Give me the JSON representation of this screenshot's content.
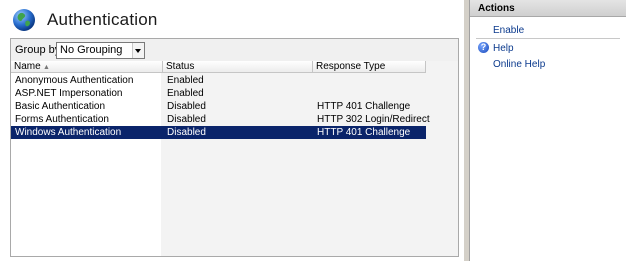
{
  "header": {
    "title": "Authentication",
    "icon": "globe-icon"
  },
  "groupby": {
    "label": "Group by:",
    "value": "No Grouping"
  },
  "table": {
    "columns": [
      "Name",
      "Status",
      "Response Type"
    ],
    "rows": [
      {
        "name": "Anonymous Authentication",
        "status": "Enabled",
        "response": ""
      },
      {
        "name": "ASP.NET Impersonation",
        "status": "Enabled",
        "response": ""
      },
      {
        "name": "Basic Authentication",
        "status": "Disabled",
        "response": "HTTP 401 Challenge"
      },
      {
        "name": "Forms Authentication",
        "status": "Disabled",
        "response": "HTTP 302 Login/Redirect"
      },
      {
        "name": "Windows Authentication",
        "status": "Disabled",
        "response": "HTTP 401 Challenge",
        "selected": true
      }
    ]
  },
  "actions": {
    "title": "Actions",
    "enable": "Enable",
    "help": "Help",
    "online_help": "Online Help"
  },
  "colors": {
    "selection": "#0a246a",
    "link": "#0b3a8d"
  }
}
